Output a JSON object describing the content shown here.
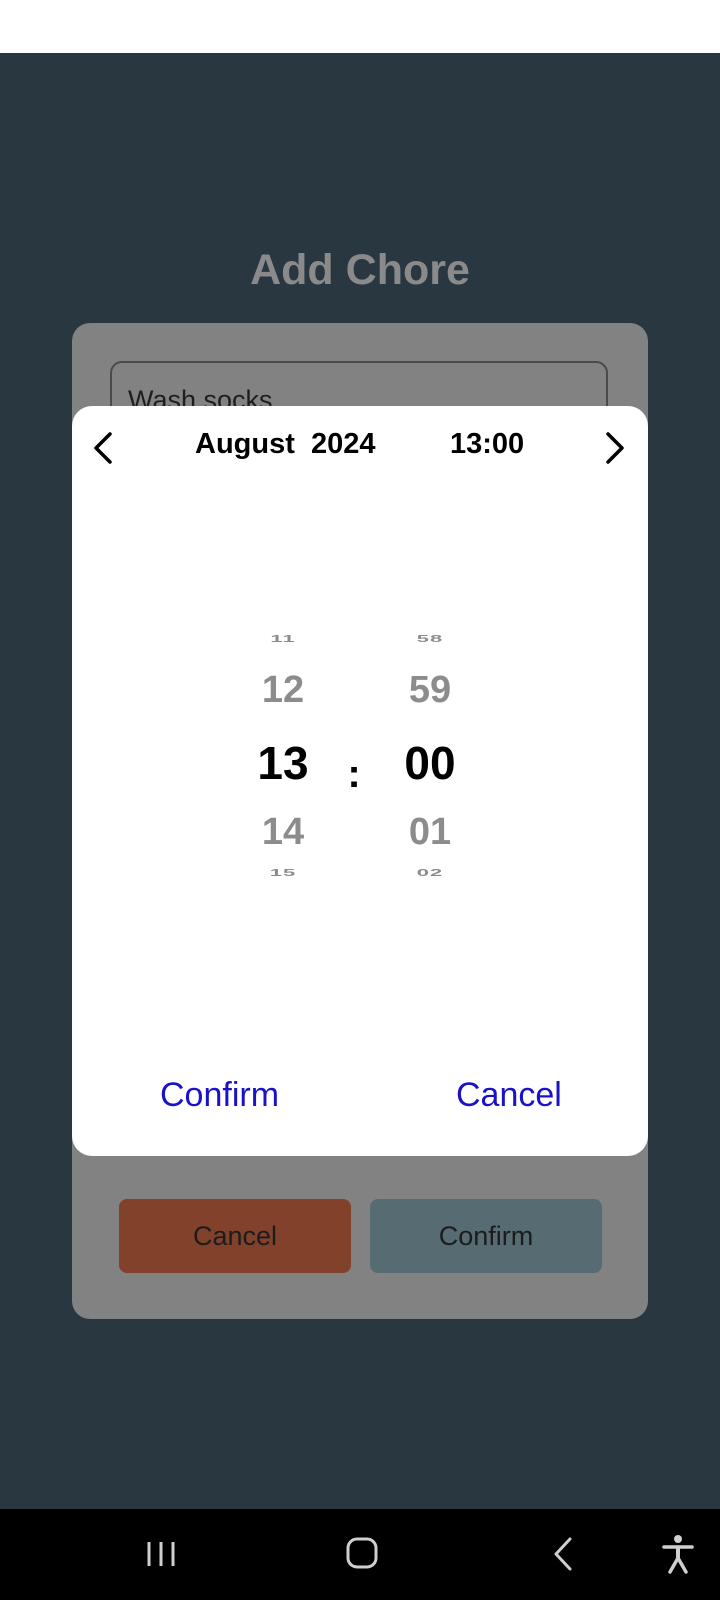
{
  "page_title": "Add Chore",
  "form": {
    "chore_name_value": "Wash socks",
    "cancel_label": "Cancel",
    "confirm_label": "Confirm"
  },
  "picker": {
    "month": "August",
    "year": "2024",
    "time": "13:00",
    "hours": {
      "far_above": "11",
      "above": "12",
      "selected": "13",
      "below": "14",
      "far_below": "15"
    },
    "minutes": {
      "far_above": "58",
      "above": "59",
      "selected": "00",
      "below": "01",
      "far_below": "02"
    },
    "separator": ":",
    "confirm_label": "Confirm",
    "cancel_label": "Cancel",
    "link_color": "#1a12c8"
  },
  "colors": {
    "app_background": "#283740",
    "form_cancel": "#82412b",
    "form_confirm": "#576b72"
  },
  "icons": {
    "prev": "chevron-left-icon",
    "next": "chevron-right-icon",
    "recents": "recent-apps-icon",
    "home": "home-icon",
    "back": "back-icon",
    "accessibility": "accessibility-icon"
  }
}
